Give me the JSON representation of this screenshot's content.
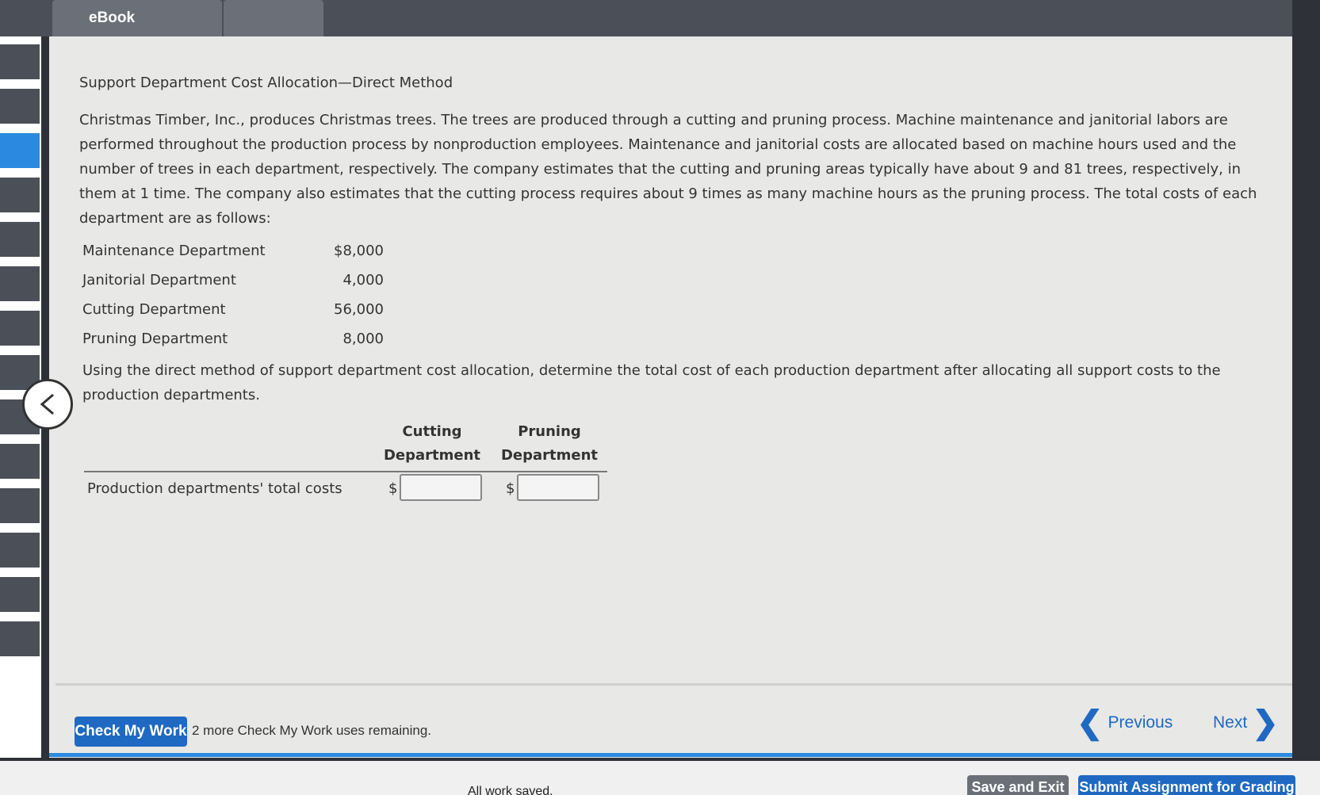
{
  "header": {
    "tabs": [
      {
        "label": "eBook"
      },
      {
        "label": ""
      }
    ]
  },
  "problem": {
    "title": "Support Department Cost Allocation—Direct Method",
    "paragraph": "Christmas Timber, Inc., produces Christmas trees. The trees are produced through a cutting and pruning process. Machine maintenance and janitorial labors are performed throughout the production process by nonproduction employees. Maintenance and janitorial costs are allocated based on machine hours used and the number of trees in each department, respectively. The company estimates that the cutting and pruning areas typically have about 9 and 81 trees, respectively, in them at 1 time. The company also estimates that the cutting process requires about 9 times as many machine hours as the pruning process. The total costs of each department are as follows:",
    "costs": [
      {
        "label": "Maintenance Department",
        "value": "$8,000"
      },
      {
        "label": "Janitorial Department",
        "value": "4,000"
      },
      {
        "label": "Cutting Department",
        "value": "56,000"
      },
      {
        "label": "Pruning Department",
        "value": "8,000"
      }
    ],
    "question": "Using the direct method of support department cost allocation, determine the total cost of each production department after allocating all support costs to the production departments."
  },
  "answer_table": {
    "col_cutting_line1": "Cutting",
    "col_cutting_line2": "Department",
    "col_pruning_line1": "Pruning",
    "col_pruning_line2": "Department",
    "row_label": "Production departments' total costs",
    "currency": "$",
    "cutting_value": "",
    "pruning_value": ""
  },
  "footer": {
    "check_button": "Check My Work",
    "check_note": "2 more Check My Work uses remaining.",
    "previous": "Previous",
    "next": "Next",
    "status": "All work saved.",
    "save_exit": "Save and Exit",
    "submit": "Submit Assignment for Grading"
  },
  "colors": {
    "accent": "#1f69c2",
    "panel": "#e8e8e7",
    "topbar": "#4b5058"
  }
}
